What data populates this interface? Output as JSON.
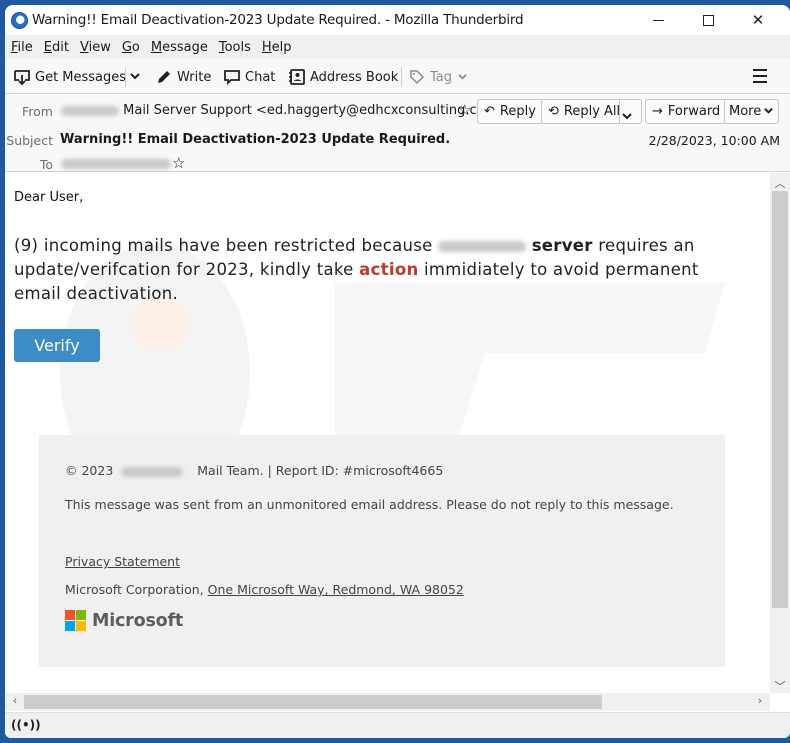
{
  "window": {
    "title": "Warning!! Email Deactivation-2023 Update Required. - Mozilla Thunderbird",
    "controls": {
      "minimize": "minimize-icon",
      "maximize": "maximize-icon",
      "close": "close-icon"
    }
  },
  "menu": [
    {
      "key": "F",
      "rest": "ile"
    },
    {
      "key": "E",
      "rest": "dit"
    },
    {
      "key": "V",
      "rest": "iew"
    },
    {
      "key": "G",
      "rest": "o"
    },
    {
      "key": "M",
      "rest": "essage"
    },
    {
      "key": "T",
      "rest": "ools"
    },
    {
      "key": "H",
      "rest": "elp"
    }
  ],
  "toolbar": {
    "get_messages": "Get Messages",
    "write": "Write",
    "chat": "Chat",
    "address_book": "Address Book",
    "tag": "Tag"
  },
  "header": {
    "from_label": "From",
    "from_name": "Mail Server Support <ed.haggerty@edhcxconsulting.com>",
    "subject_label": "Subject",
    "subject": "Warning!! Email Deactivation-2023 Update Required.",
    "to_label": "To",
    "date": "2/28/2023, 10:00 AM",
    "buttons": {
      "reply": "Reply",
      "reply_all": "Reply All",
      "forward": "Forward",
      "more": "More"
    }
  },
  "message": {
    "greeting": "Dear User,",
    "para_part1": "(9) incoming mails have been restricted because",
    "para_bold1": "server",
    "para_part2": "requires an update/verifcation for 2023, kindly take",
    "para_action": "action",
    "para_part3": "immidiately to avoid permanent email deactivation.",
    "verify_button": "Verify",
    "accent_color": "#c0392b",
    "button_color": "#3d8cc8"
  },
  "footer": {
    "copyright_prefix": "© 2023",
    "copyright_suffix": "Mail Team. | Report ID: #microsoft4665",
    "notice": "This message was sent from an unmonitored email address. Please do not reply to this message.",
    "privacy_link": "Privacy Statement",
    "corp_prefix": "Microsoft Corporation,",
    "corp_address": "One Microsoft Way, Redmond, WA 98052",
    "logo_text": "Microsoft",
    "logo_colors": [
      "#f25022",
      "#7fba00",
      "#00a4ef",
      "#ffb900"
    ]
  }
}
